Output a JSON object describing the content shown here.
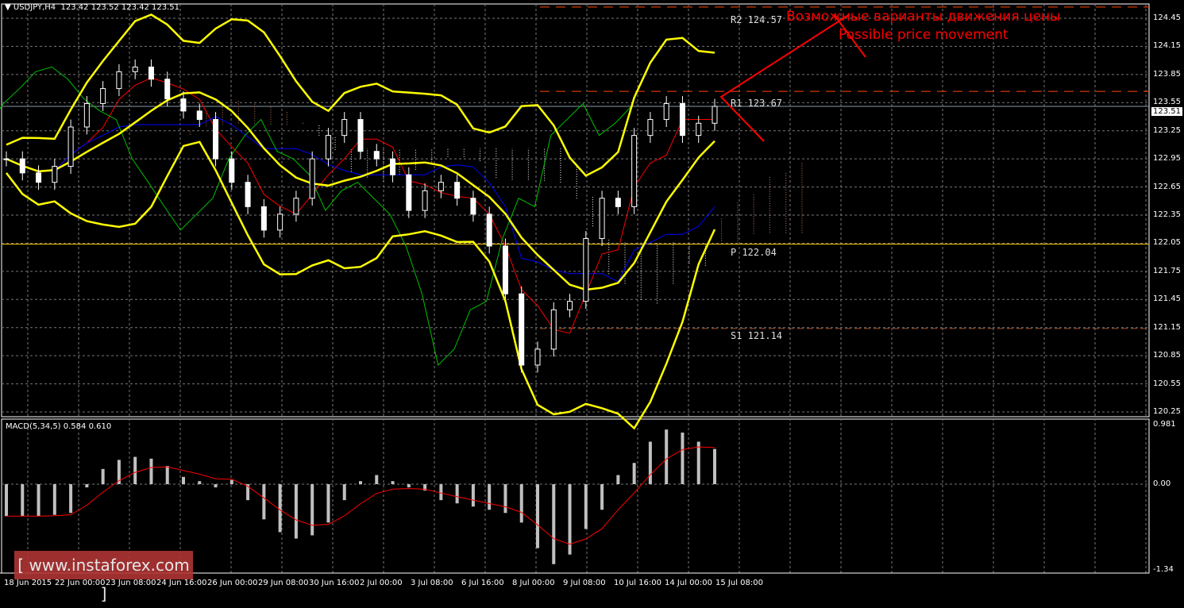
{
  "header": {
    "symbol": "USDJPY,H4",
    "ohlc": "123.42 123.52 123.42 123.51"
  },
  "macd_label": "MACD(5,34,5) 0.584 0.610",
  "annotation": {
    "ru": "Возможные варианты движения цены",
    "en": "Possible price movement"
  },
  "pivots": {
    "r2": "R2 124.57",
    "r1": "R1 123.67",
    "p": "P 122.04",
    "s1": "S1 121.14"
  },
  "current_price": "123.51",
  "watermark": "[ www.instaforex.com ]",
  "colors": {
    "bollinger": "#ffff00",
    "tenkan": "#ff0000",
    "kijun": "#0000ff",
    "chikou": "#00c000",
    "pivot": "#ffcc00",
    "resistance": "#ff4500",
    "macd_hist": "#c0c0c0",
    "macd_signal": "#ff0000"
  },
  "chart_data": {
    "type": "candlestick",
    "title": "USDJPY,H4",
    "price_ticks": [
      "124.45",
      "124.15",
      "123.85",
      "123.55",
      "123.25",
      "122.95",
      "122.65",
      "122.35",
      "122.05",
      "121.75",
      "121.45",
      "121.15",
      "120.85",
      "120.55",
      "120.25"
    ],
    "ylim": [
      120.2,
      124.6
    ],
    "x_ticks": [
      "18 Jun 2015",
      "22 Jun 00:00",
      "23 Jun 08:00",
      "24 Jun 16:00",
      "26 Jun 00:00",
      "29 Jun 08:00",
      "30 Jun 16:00",
      "2 Jul 00:00",
      "3 Jul 08:00",
      "6 Jul 16:00",
      "8 Jul 00:00",
      "9 Jul 08:00",
      "10 Jul 16:00",
      "14 Jul 00:00",
      "15 Jul 08:00"
    ],
    "closes": [
      122.95,
      122.8,
      122.7,
      122.87,
      123.29,
      123.54,
      123.7,
      123.88,
      123.93,
      123.8,
      123.59,
      123.46,
      123.37,
      122.95,
      122.7,
      122.44,
      122.19,
      122.36,
      122.53,
      122.95,
      123.2,
      123.37,
      123.03,
      122.95,
      122.78,
      122.4,
      122.61,
      122.7,
      122.53,
      122.36,
      122.02,
      121.51,
      120.75,
      120.92,
      121.34,
      121.43,
      122.1,
      122.53,
      122.44,
      123.2,
      123.37,
      123.54,
      123.2,
      123.33,
      123.51
    ],
    "macd_ticks": [
      "0.981",
      "0.00",
      "-1.34"
    ],
    "macd_hist": [
      -0.5,
      -0.5,
      -0.5,
      -0.48,
      -0.45,
      -0.05,
      0.25,
      0.4,
      0.45,
      0.42,
      0.3,
      0.12,
      0.05,
      -0.05,
      0.07,
      -0.25,
      -0.55,
      -0.75,
      -0.85,
      -0.8,
      -0.6,
      -0.25,
      0.05,
      0.15,
      0.05,
      -0.05,
      -0.1,
      -0.25,
      -0.3,
      -0.35,
      -0.4,
      -0.45,
      -0.6,
      -1.0,
      -1.25,
      -1.1,
      -0.7,
      -0.4,
      0.15,
      0.35,
      0.7,
      0.9,
      0.85,
      0.7,
      0.58
    ],
    "pivot_levels": {
      "R2": 124.57,
      "R1": 123.67,
      "P": 122.04,
      "S1": 121.14
    },
    "current": 123.51
  }
}
